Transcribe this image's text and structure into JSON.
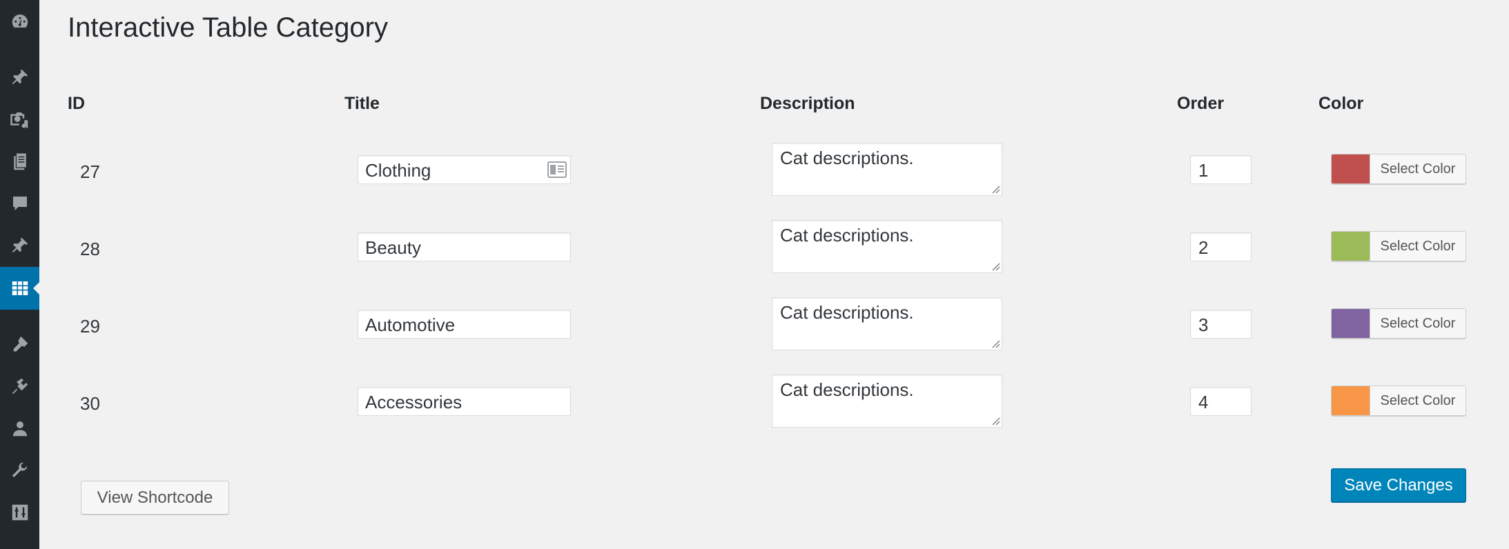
{
  "sidebar": {
    "icons": [
      "dashboard-icon",
      "pin-icon",
      "media-icon",
      "pages-icon",
      "comments-icon",
      "pin-icon",
      "table-icon",
      "brush-icon",
      "plugin-icon",
      "user-icon",
      "wrench-icon",
      "settings-icon"
    ],
    "active_index": 6
  },
  "page": {
    "title": "Interactive Table Category"
  },
  "table": {
    "headers": {
      "id": "ID",
      "title": "Title",
      "description": "Description",
      "order": "Order",
      "color": "Color"
    },
    "rows": [
      {
        "id": "27",
        "title": "Clothing",
        "description": "Cat descriptions.",
        "order": "1",
        "color": "#c0504d",
        "color_label": "Select Color"
      },
      {
        "id": "28",
        "title": "Beauty",
        "description": "Cat descriptions.",
        "order": "2",
        "color": "#9bbb59",
        "color_label": "Select Color"
      },
      {
        "id": "29",
        "title": "Automotive",
        "description": "Cat descriptions.",
        "order": "3",
        "color": "#8064a2",
        "color_label": "Select Color"
      },
      {
        "id": "30",
        "title": "Accessories",
        "description": "Cat descriptions.",
        "order": "4",
        "color": "#f79646",
        "color_label": "Select Color"
      }
    ]
  },
  "buttons": {
    "view_shortcode": "View Shortcode",
    "save_changes": "Save Changes"
  },
  "colors": {
    "sidebar_bg": "#23282d",
    "accent": "#0073aa",
    "primary_button": "#0085ba"
  }
}
